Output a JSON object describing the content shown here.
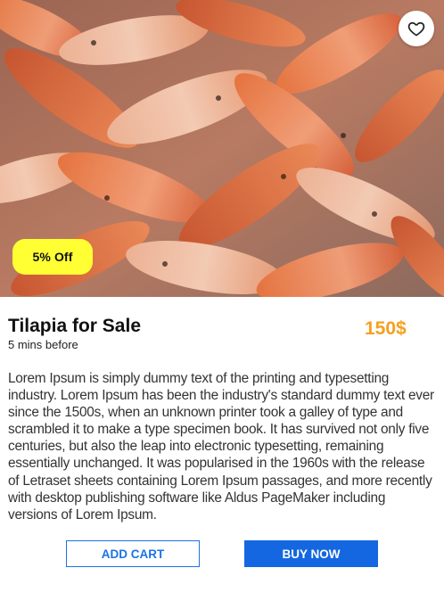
{
  "product": {
    "image_alt": "School of orange and red tilapia fish crowded in water",
    "favorite_icon": "heart-outline-icon",
    "discount_label": "5% Off",
    "title": "Tilapia for Sale",
    "posted_time": "5 mins before",
    "price": "150$",
    "description": "Lorem Ipsum is simply dummy text of the printing and typesetting industry. Lorem Ipsum has been the industry's standard dummy text ever since the 1500s, when an unknown printer took a galley of type and scrambled it to make a type specimen book. It has survived not only five centuries, but also the leap into electronic typesetting, remaining essentially unchanged. It was popularised in the 1960s with the release of Letraset sheets containing Lorem Ipsum passages, and more recently with desktop publishing software like Aldus PageMaker including versions of Lorem Ipsum."
  },
  "actions": {
    "add_cart_label": "ADD CART",
    "buy_now_label": "BUY NOW"
  },
  "colors": {
    "discount_badge": "#ffff33",
    "price": "#f5a020",
    "primary_button": "#1467e0"
  }
}
